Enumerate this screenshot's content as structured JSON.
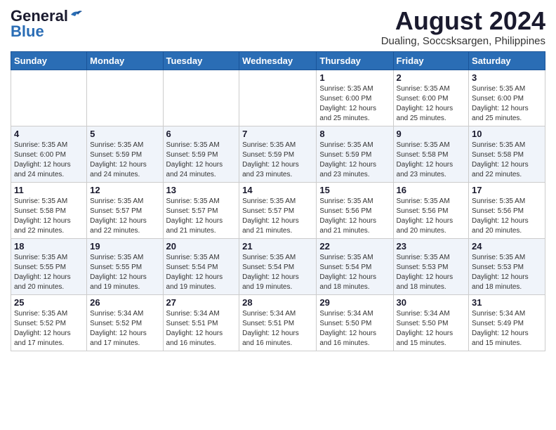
{
  "logo": {
    "line1": "General",
    "line2": "Blue"
  },
  "title": "August 2024",
  "subtitle": "Dualing, Soccsksargen, Philippines",
  "days_of_week": [
    "Sunday",
    "Monday",
    "Tuesday",
    "Wednesday",
    "Thursday",
    "Friday",
    "Saturday"
  ],
  "weeks": [
    [
      {
        "day": "",
        "info": ""
      },
      {
        "day": "",
        "info": ""
      },
      {
        "day": "",
        "info": ""
      },
      {
        "day": "",
        "info": ""
      },
      {
        "day": "1",
        "info": "Sunrise: 5:35 AM\nSunset: 6:00 PM\nDaylight: 12 hours\nand 25 minutes."
      },
      {
        "day": "2",
        "info": "Sunrise: 5:35 AM\nSunset: 6:00 PM\nDaylight: 12 hours\nand 25 minutes."
      },
      {
        "day": "3",
        "info": "Sunrise: 5:35 AM\nSunset: 6:00 PM\nDaylight: 12 hours\nand 25 minutes."
      }
    ],
    [
      {
        "day": "4",
        "info": "Sunrise: 5:35 AM\nSunset: 6:00 PM\nDaylight: 12 hours\nand 24 minutes."
      },
      {
        "day": "5",
        "info": "Sunrise: 5:35 AM\nSunset: 5:59 PM\nDaylight: 12 hours\nand 24 minutes."
      },
      {
        "day": "6",
        "info": "Sunrise: 5:35 AM\nSunset: 5:59 PM\nDaylight: 12 hours\nand 24 minutes."
      },
      {
        "day": "7",
        "info": "Sunrise: 5:35 AM\nSunset: 5:59 PM\nDaylight: 12 hours\nand 23 minutes."
      },
      {
        "day": "8",
        "info": "Sunrise: 5:35 AM\nSunset: 5:59 PM\nDaylight: 12 hours\nand 23 minutes."
      },
      {
        "day": "9",
        "info": "Sunrise: 5:35 AM\nSunset: 5:58 PM\nDaylight: 12 hours\nand 23 minutes."
      },
      {
        "day": "10",
        "info": "Sunrise: 5:35 AM\nSunset: 5:58 PM\nDaylight: 12 hours\nand 22 minutes."
      }
    ],
    [
      {
        "day": "11",
        "info": "Sunrise: 5:35 AM\nSunset: 5:58 PM\nDaylight: 12 hours\nand 22 minutes."
      },
      {
        "day": "12",
        "info": "Sunrise: 5:35 AM\nSunset: 5:57 PM\nDaylight: 12 hours\nand 22 minutes."
      },
      {
        "day": "13",
        "info": "Sunrise: 5:35 AM\nSunset: 5:57 PM\nDaylight: 12 hours\nand 21 minutes."
      },
      {
        "day": "14",
        "info": "Sunrise: 5:35 AM\nSunset: 5:57 PM\nDaylight: 12 hours\nand 21 minutes."
      },
      {
        "day": "15",
        "info": "Sunrise: 5:35 AM\nSunset: 5:56 PM\nDaylight: 12 hours\nand 21 minutes."
      },
      {
        "day": "16",
        "info": "Sunrise: 5:35 AM\nSunset: 5:56 PM\nDaylight: 12 hours\nand 20 minutes."
      },
      {
        "day": "17",
        "info": "Sunrise: 5:35 AM\nSunset: 5:56 PM\nDaylight: 12 hours\nand 20 minutes."
      }
    ],
    [
      {
        "day": "18",
        "info": "Sunrise: 5:35 AM\nSunset: 5:55 PM\nDaylight: 12 hours\nand 20 minutes."
      },
      {
        "day": "19",
        "info": "Sunrise: 5:35 AM\nSunset: 5:55 PM\nDaylight: 12 hours\nand 19 minutes."
      },
      {
        "day": "20",
        "info": "Sunrise: 5:35 AM\nSunset: 5:54 PM\nDaylight: 12 hours\nand 19 minutes."
      },
      {
        "day": "21",
        "info": "Sunrise: 5:35 AM\nSunset: 5:54 PM\nDaylight: 12 hours\nand 19 minutes."
      },
      {
        "day": "22",
        "info": "Sunrise: 5:35 AM\nSunset: 5:54 PM\nDaylight: 12 hours\nand 18 minutes."
      },
      {
        "day": "23",
        "info": "Sunrise: 5:35 AM\nSunset: 5:53 PM\nDaylight: 12 hours\nand 18 minutes."
      },
      {
        "day": "24",
        "info": "Sunrise: 5:35 AM\nSunset: 5:53 PM\nDaylight: 12 hours\nand 18 minutes."
      }
    ],
    [
      {
        "day": "25",
        "info": "Sunrise: 5:35 AM\nSunset: 5:52 PM\nDaylight: 12 hours\nand 17 minutes."
      },
      {
        "day": "26",
        "info": "Sunrise: 5:34 AM\nSunset: 5:52 PM\nDaylight: 12 hours\nand 17 minutes."
      },
      {
        "day": "27",
        "info": "Sunrise: 5:34 AM\nSunset: 5:51 PM\nDaylight: 12 hours\nand 16 minutes."
      },
      {
        "day": "28",
        "info": "Sunrise: 5:34 AM\nSunset: 5:51 PM\nDaylight: 12 hours\nand 16 minutes."
      },
      {
        "day": "29",
        "info": "Sunrise: 5:34 AM\nSunset: 5:50 PM\nDaylight: 12 hours\nand 16 minutes."
      },
      {
        "day": "30",
        "info": "Sunrise: 5:34 AM\nSunset: 5:50 PM\nDaylight: 12 hours\nand 15 minutes."
      },
      {
        "day": "31",
        "info": "Sunrise: 5:34 AM\nSunset: 5:49 PM\nDaylight: 12 hours\nand 15 minutes."
      }
    ]
  ]
}
